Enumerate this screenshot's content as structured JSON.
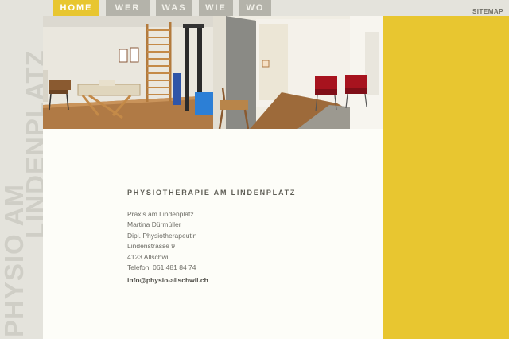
{
  "logo": {
    "line1": "PHYSIO AM",
    "line2": "LINDENPLATZ"
  },
  "nav": {
    "items": [
      {
        "label": "HOME",
        "active": true
      },
      {
        "label": "WER",
        "active": false
      },
      {
        "label": "WAS",
        "active": false
      },
      {
        "label": "WIE",
        "active": false
      },
      {
        "label": "WO",
        "active": false
      }
    ]
  },
  "header": {
    "sitemap_label": "SITEMAP"
  },
  "main": {
    "title": "PHYSIOTHERAPIE AM LINDENPLATZ",
    "address": [
      "Praxis am Lindenplatz",
      "Martina Dürmüller",
      "Dipl. Physiotherapeutin",
      "Lindenstrasse 9",
      "4123 Allschwil",
      "Telefon: 061 481 84 74"
    ],
    "email": "info@physio-allschwil.ch"
  },
  "colors": {
    "accent": "#e8c630",
    "nav_inactive": "#b4b3aa",
    "background": "#e4e3dc",
    "content_bg": "#fdfdf8"
  }
}
